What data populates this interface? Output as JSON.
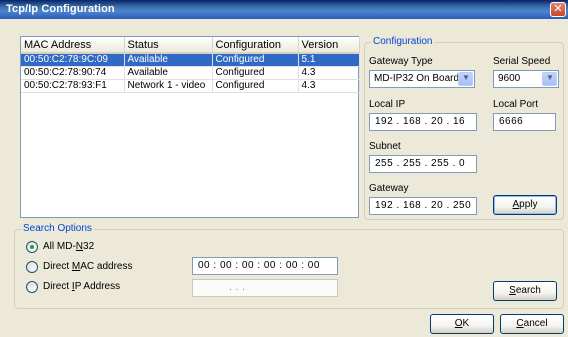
{
  "window": {
    "title": "Tcp/Ip Configuration",
    "close_glyph": "✕"
  },
  "devices": {
    "columns": [
      "MAC Address",
      "Status",
      "Configuration",
      "Version"
    ],
    "rows": [
      {
        "mac": "00:50:C2:78:9C:09",
        "status": "Available",
        "configuration": "Configured",
        "version": "5.1",
        "selected": true
      },
      {
        "mac": "00:50:C2:78:90:74",
        "status": "Available",
        "configuration": "Configured",
        "version": "4.3",
        "selected": false
      },
      {
        "mac": "00:50:C2:78:93:F1",
        "status": "Network 1 - video",
        "configuration": "Configured",
        "version": "4.3",
        "selected": false
      }
    ]
  },
  "configuration": {
    "legend": "Configuration",
    "gateway_type_label": "Gateway Type",
    "gateway_type_value": "MD-IP32 On Board",
    "serial_speed_label": "Serial Speed",
    "serial_speed_value": "9600",
    "local_ip_label": "Local IP",
    "local_ip_value": "192 . 168 . 20 . 16",
    "local_port_label": "Local Port",
    "local_port_value": "6666",
    "subnet_label": "Subnet",
    "subnet_value": "255 . 255 . 255 . 0",
    "gateway_label": "Gateway",
    "gateway_value": "192 . 168 . 20 . 250",
    "apply": {
      "before": "",
      "key": "A",
      "after": "pply"
    }
  },
  "search_options": {
    "legend": "Search Options",
    "all": {
      "before": "All MD-",
      "key": "N",
      "after": "32"
    },
    "direct_mac": {
      "before": "Direct ",
      "key": "M",
      "after": "AC address"
    },
    "direct_ip": {
      "before": "Direct ",
      "key": "I",
      "after": "P Address"
    },
    "mac_value": "00 : 00 : 00 : 00 : 00 : 00",
    "ip_value": ".        .        .",
    "selected": "all",
    "search": {
      "before": "",
      "key": "S",
      "after": "earch"
    }
  },
  "dialog_buttons": {
    "ok": {
      "before": "",
      "key": "O",
      "after": "K"
    },
    "cancel": {
      "before": "",
      "key": "C",
      "after": "ancel"
    }
  },
  "icons": {
    "dropdown": "chevron-down-icon",
    "close": "close-icon",
    "radio_selected": "radio-selected-icon"
  }
}
